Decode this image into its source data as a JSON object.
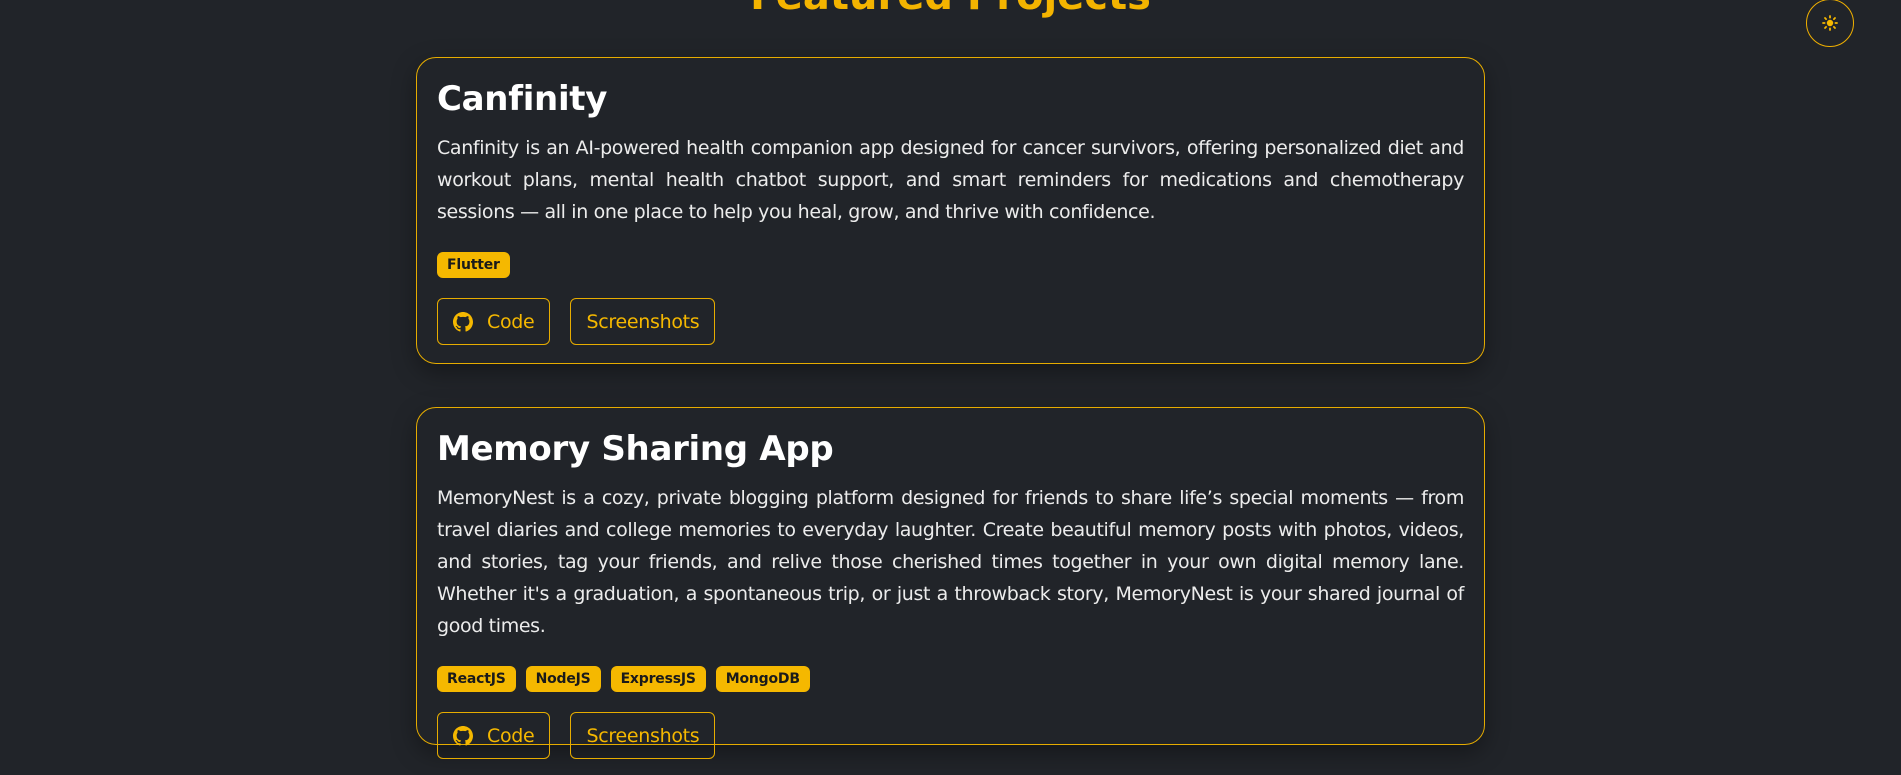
{
  "section": {
    "title": "Featured Projects"
  },
  "theme_toggle": {
    "icon": "sun-icon",
    "color": "#f5b800"
  },
  "projects": [
    {
      "title": "Canfinity",
      "description": "Canfinity is an AI-powered health companion app designed for cancer survivors, offering personalized diet and workout plans, mental health chatbot support, and smart reminders for medications and chemotherapy sessions — all in one place to help you heal, grow, and thrive with confidence.",
      "tags": [
        "Flutter"
      ],
      "code_label": "Code",
      "screenshots_label": "Screenshots"
    },
    {
      "title": "Memory Sharing App",
      "description": "MemoryNest is a cozy, private blogging platform designed for friends to share life’s special moments — from travel diaries and college memories to everyday laughter. Create beautiful memory posts with photos, videos, and stories, tag your friends, and relive those cherished times together in your own digital memory lane. Whether it's a graduation, a spontaneous trip, or just a throwback story, MemoryNest is your shared journal of good times.",
      "tags": [
        "ReactJS",
        "NodeJS",
        "ExpressJS",
        "MongoDB"
      ],
      "code_label": "Code",
      "screenshots_label": "Screenshots"
    }
  ],
  "colors": {
    "background": "#212429",
    "accent": "#f5b800",
    "text": "#ffffff"
  }
}
